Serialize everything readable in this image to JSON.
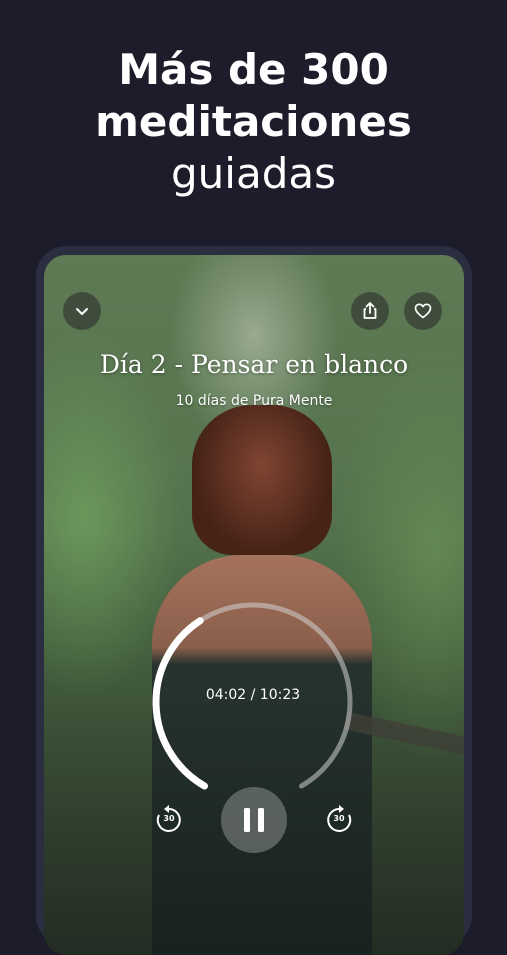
{
  "headline": {
    "line1": "Más de 300",
    "line2": "meditaciones",
    "line3": "guiadas"
  },
  "player": {
    "title": "Día 2 - Pensar en blanco",
    "subtitle": "10 días de Pura Mente",
    "time_display": "04:02 / 10:23",
    "progress_fraction": 0.39,
    "skip_back_seconds": "30",
    "skip_forward_seconds": "30"
  },
  "icons": {
    "collapse": "chevron-down-icon",
    "share": "share-icon",
    "favorite": "heart-icon",
    "pause": "pause-icon",
    "rewind": "rewind-30-icon",
    "forward": "forward-30-icon"
  },
  "colors": {
    "background": "#1c1c2a",
    "device_frame": "#2b2d40",
    "text": "#ffffff"
  }
}
